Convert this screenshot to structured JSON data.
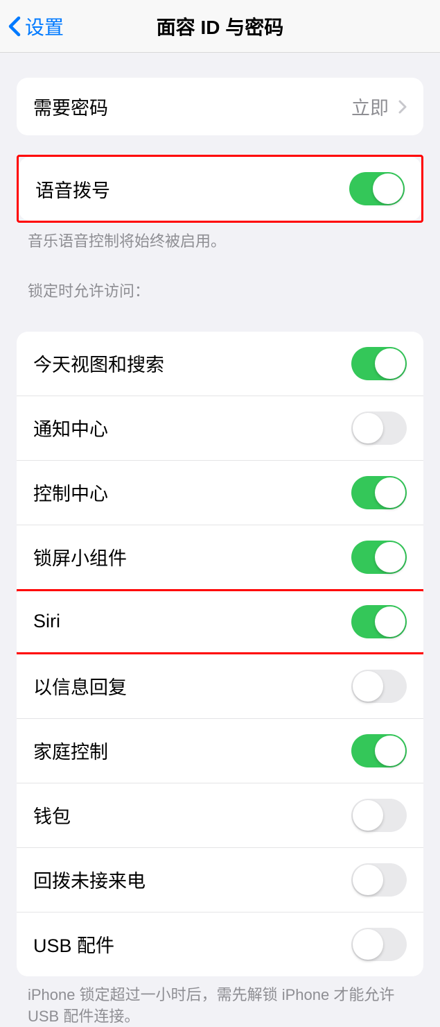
{
  "header": {
    "back_label": "设置",
    "title": "面容 ID 与密码"
  },
  "passcode_group": {
    "require_passcode_label": "需要密码",
    "require_passcode_value": "立即"
  },
  "voice_dial": {
    "label": "语音拨号",
    "on": true,
    "footer": "音乐语音控制将始终被启用。"
  },
  "lock_access": {
    "header": "锁定时允许访问：",
    "items": [
      {
        "label": "今天视图和搜索",
        "on": true
      },
      {
        "label": "通知中心",
        "on": false
      },
      {
        "label": "控制中心",
        "on": true
      },
      {
        "label": "锁屏小组件",
        "on": true
      },
      {
        "label": "Siri",
        "on": true
      },
      {
        "label": "以信息回复",
        "on": false
      },
      {
        "label": "家庭控制",
        "on": true
      },
      {
        "label": "钱包",
        "on": false
      },
      {
        "label": "回拨未接来电",
        "on": false
      },
      {
        "label": "USB 配件",
        "on": false
      }
    ],
    "footer": "iPhone 锁定超过一小时后，需先解锁 iPhone 才能允许 USB 配件连接。"
  }
}
